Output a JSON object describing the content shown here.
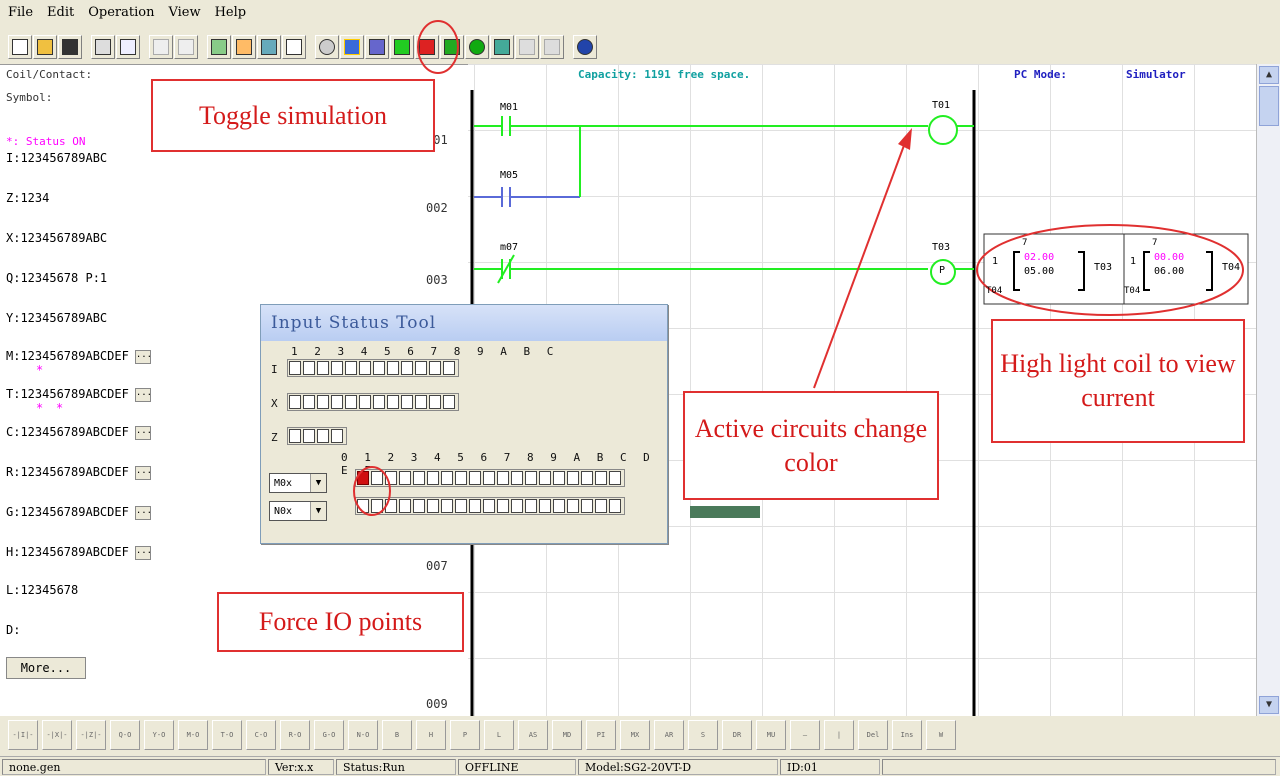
{
  "menu": [
    "File",
    "Edit",
    "Operation",
    "View",
    "Help"
  ],
  "info": {
    "coil_contact": "Coil/Contact:",
    "symbol": "Symbol:",
    "status_on": "*: Status ON",
    "capacity": "Capacity: 1191 free space.",
    "pc_mode_label": "PC Mode:",
    "pc_mode_value": "Simulator"
  },
  "left_lines": {
    "I": "I:123456789ABC",
    "Z": "Z:1234",
    "X": "X:123456789ABC",
    "Q": "Q:12345678 P:1",
    "Y": "Y:123456789ABC",
    "M": "M:123456789ABCDEF",
    "T": "T:123456789ABCDEF",
    "C": "C:123456789ABCDEF",
    "R": "R:123456789ABCDEF",
    "G": "G:123456789ABCDEF",
    "H": "H:123456789ABCDEF",
    "L": "L:12345678",
    "D": "D:",
    "more": "More..."
  },
  "row_numbers": [
    "001",
    "002",
    "003",
    "007",
    "009"
  ],
  "ladder": {
    "c1": "M01",
    "c2": "M05",
    "c3": "m07",
    "coil1": "T01",
    "coil2": "T03",
    "coil2_mark": "P",
    "timer": {
      "left_prefix": "1",
      "left_top": "7",
      "left_cur": "02.00",
      "left_set": "05.00",
      "left_name": "T03",
      "left_foot": "T04",
      "right_prefix": "1",
      "right_top": "7",
      "right_cur": "00.00",
      "right_set": "06.00",
      "right_name": "T04",
      "right_foot": "T04"
    }
  },
  "dialog": {
    "title": "Input Status Tool",
    "header_i": "1 2 3 4 5 6 7 8 9 A B C",
    "lbl_i": "I",
    "lbl_x": "X",
    "lbl_z": "Z",
    "header_m": "0 1 2 3 4 5 6 7 8 9 A B C D E F",
    "sel_m": "M0x",
    "sel_n": "N0x"
  },
  "callouts": {
    "toggle": "Toggle simulation",
    "active": "Active  circuits change color",
    "highlight": "High  light  coil to view current",
    "force": "Force IO points"
  },
  "status": {
    "file": "none.gen",
    "ver": "Ver:x.x",
    "run": "Status:Run",
    "conn": "OFFLINE",
    "model": "Model:SG2-20VT-D",
    "id": "ID:01"
  },
  "colors": {
    "energized": "#22ee22",
    "inactive": "#5a6ad8",
    "annotation": "#e03030",
    "current_value": "#ff00ff"
  }
}
